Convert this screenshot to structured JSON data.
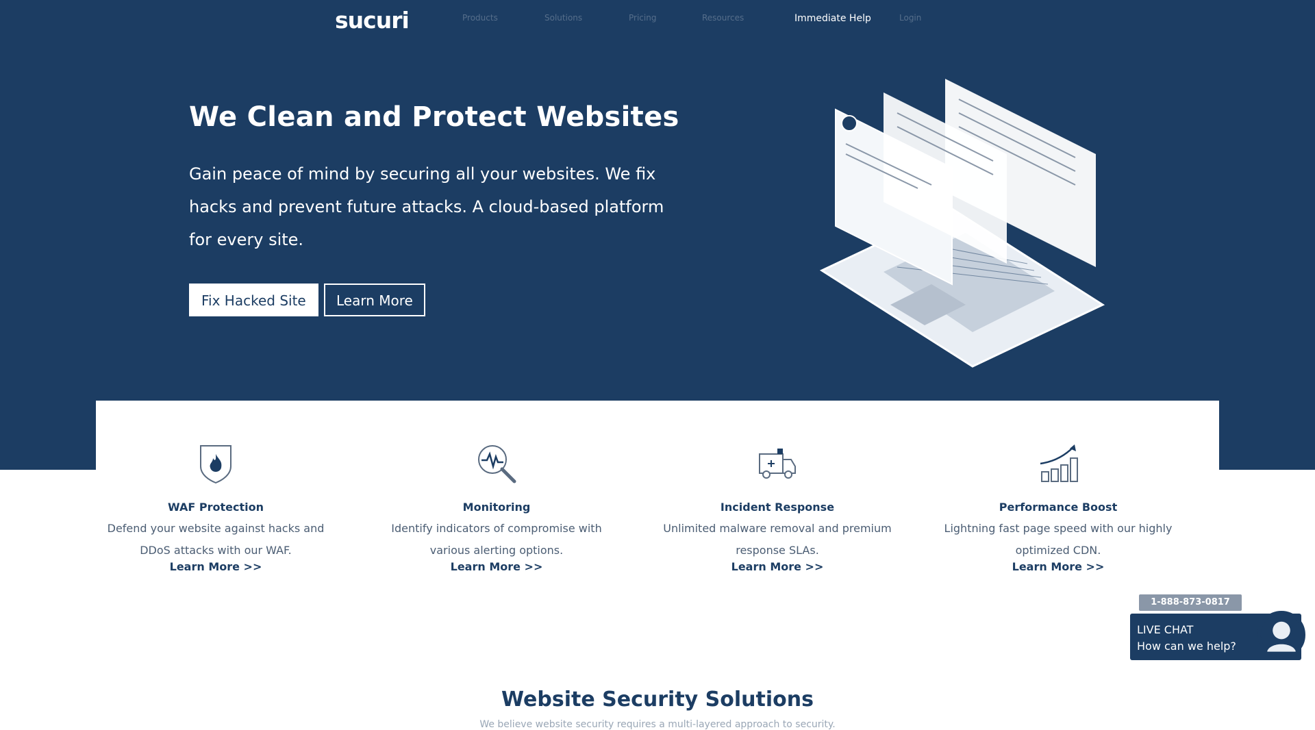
{
  "nav": {
    "logo": "sucuri",
    "items": [
      "Products",
      "Solutions",
      "Pricing",
      "Resources"
    ],
    "immediate_help": "Immediate Help",
    "login": "Login"
  },
  "hero": {
    "title": "We Clean and Protect Websites",
    "subtitle": "Gain peace of mind by securing all your websites. We fix hacks and prevent future attacks. A cloud-based platform for every site.",
    "btn_primary": "Fix Hacked Site",
    "btn_secondary": "Learn More"
  },
  "features": [
    {
      "icon": "shield-flame-icon",
      "title": "WAF Protection",
      "desc": "Defend your website against hacks and DDoS attacks with our WAF.",
      "link": "Learn More >>"
    },
    {
      "icon": "magnifier-pulse-icon",
      "title": "Monitoring",
      "desc": "Identify indicators of compromise with various alerting options.",
      "link": "Learn More >>"
    },
    {
      "icon": "ambulance-icon",
      "title": "Incident Response",
      "desc": "Unlimited malware removal and premium response SLAs.",
      "link": "Learn More >>"
    },
    {
      "icon": "growth-chart-icon",
      "title": "Performance Boost",
      "desc": "Lightning fast page speed with our highly optimized CDN.",
      "link": "Learn More >>"
    }
  ],
  "chat": {
    "phone": "1-888-873-0817",
    "title": "LIVE CHAT",
    "subtitle": "How can we help?"
  },
  "solutions": {
    "title": "Website Security Solutions",
    "desc": "We believe website security requires a multi-layered approach to security."
  },
  "colors": {
    "primary": "#1c3d63",
    "text_muted": "#4b5d73",
    "white": "#ffffff"
  }
}
